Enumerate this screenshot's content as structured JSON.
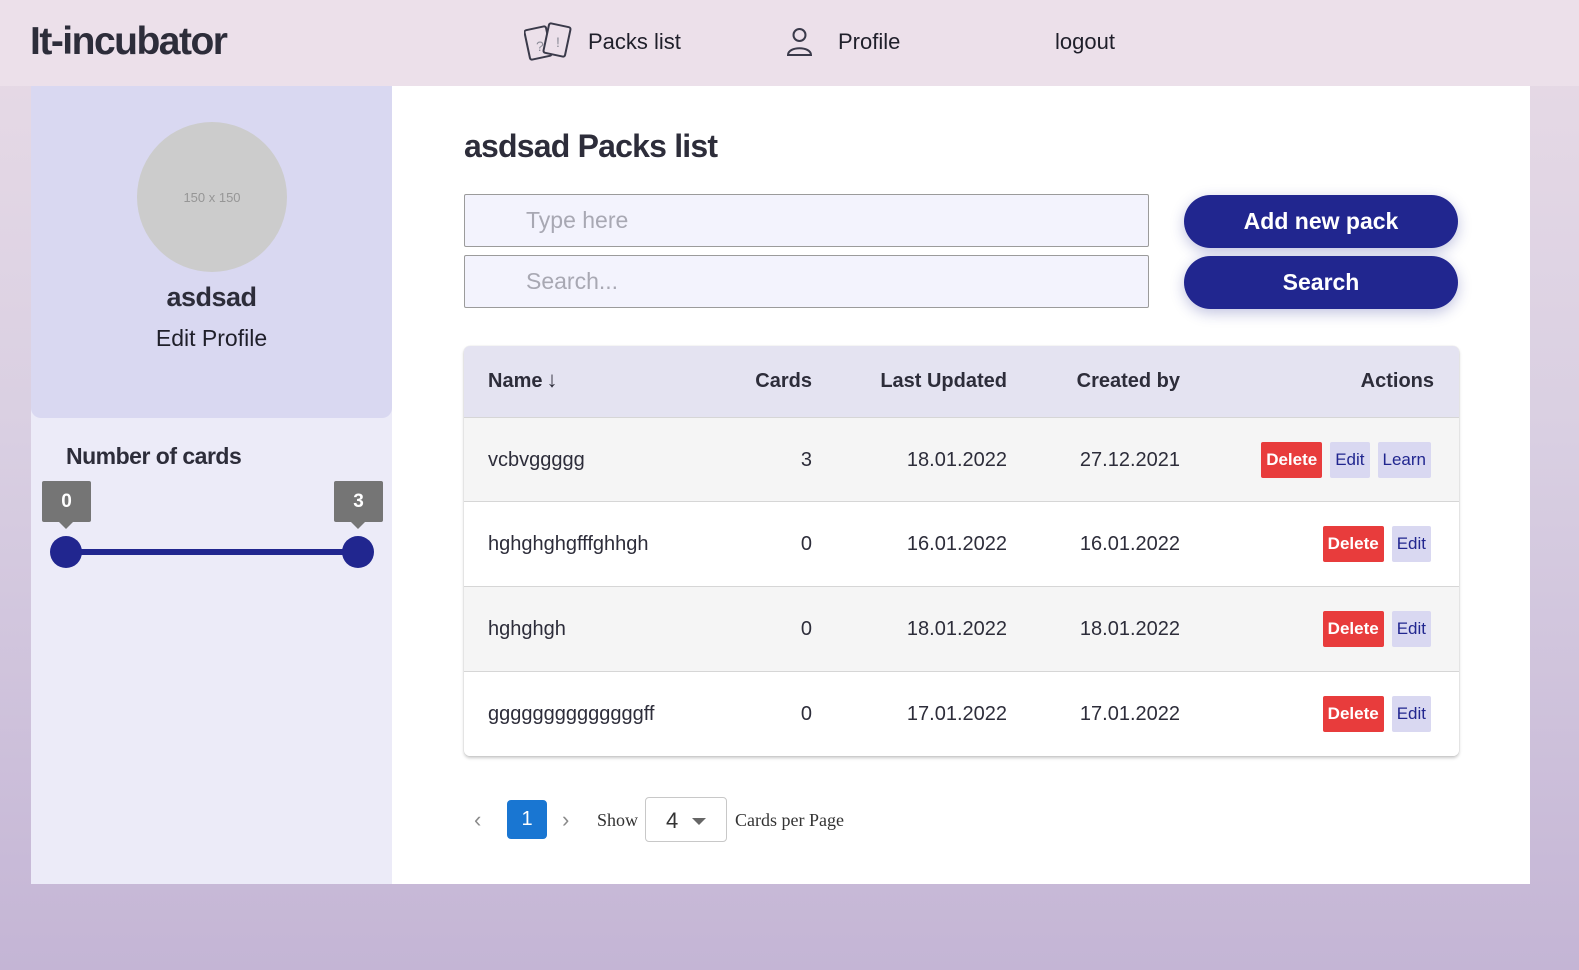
{
  "header": {
    "logo": "It-incubator",
    "nav": [
      {
        "label": "Packs list",
        "icon": "cards-icon"
      },
      {
        "label": "Profile",
        "icon": "user-icon"
      },
      {
        "label": "logout"
      }
    ]
  },
  "sidebar": {
    "avatar_placeholder": "150 x 150",
    "username": "asdsad",
    "edit_profile_label": "Edit Profile",
    "number_of_cards_label": "Number of cards",
    "range": {
      "min": 0,
      "max": 3,
      "min_label": "0",
      "max_label": "3"
    }
  },
  "main": {
    "title": "asdsad Packs list",
    "inputs": {
      "type_placeholder": "Type here",
      "search_placeholder": "Search..."
    },
    "buttons": {
      "add_new_pack": "Add new pack",
      "search": "Search"
    },
    "table": {
      "headers": {
        "name": "Name",
        "sort_arrow": "↓",
        "cards": "Cards",
        "last_updated": "Last Updated",
        "created_by": "Created by",
        "actions": "Actions"
      },
      "rows": [
        {
          "name": "vcbvggggg",
          "cards": "3",
          "last_updated": "18.01.2022",
          "created_by": "27.12.2021",
          "actions": [
            "Delete",
            "Edit",
            "Learn"
          ]
        },
        {
          "name": "hghghghgfffghhgh",
          "cards": "0",
          "last_updated": "16.01.2022",
          "created_by": "16.01.2022",
          "actions": [
            "Delete",
            "Edit"
          ]
        },
        {
          "name": "hghghgh",
          "cards": "0",
          "last_updated": "18.01.2022",
          "created_by": "18.01.2022",
          "actions": [
            "Delete",
            "Edit"
          ]
        },
        {
          "name": "ggggggggggggggff",
          "cards": "0",
          "last_updated": "17.01.2022",
          "created_by": "17.01.2022",
          "actions": [
            "Delete",
            "Edit"
          ]
        }
      ]
    },
    "pagination": {
      "prev": "‹",
      "current_page": "1",
      "next": "›",
      "show_label": "Show",
      "per_page_value": "4",
      "per_page_suffix": "Cards per Page"
    }
  },
  "colors": {
    "primary": "#21268f",
    "danger": "#e83c3c",
    "page_active": "#1976d2",
    "sidebar_card": "#d9d8f1",
    "table_header": "#e4e3f1"
  }
}
